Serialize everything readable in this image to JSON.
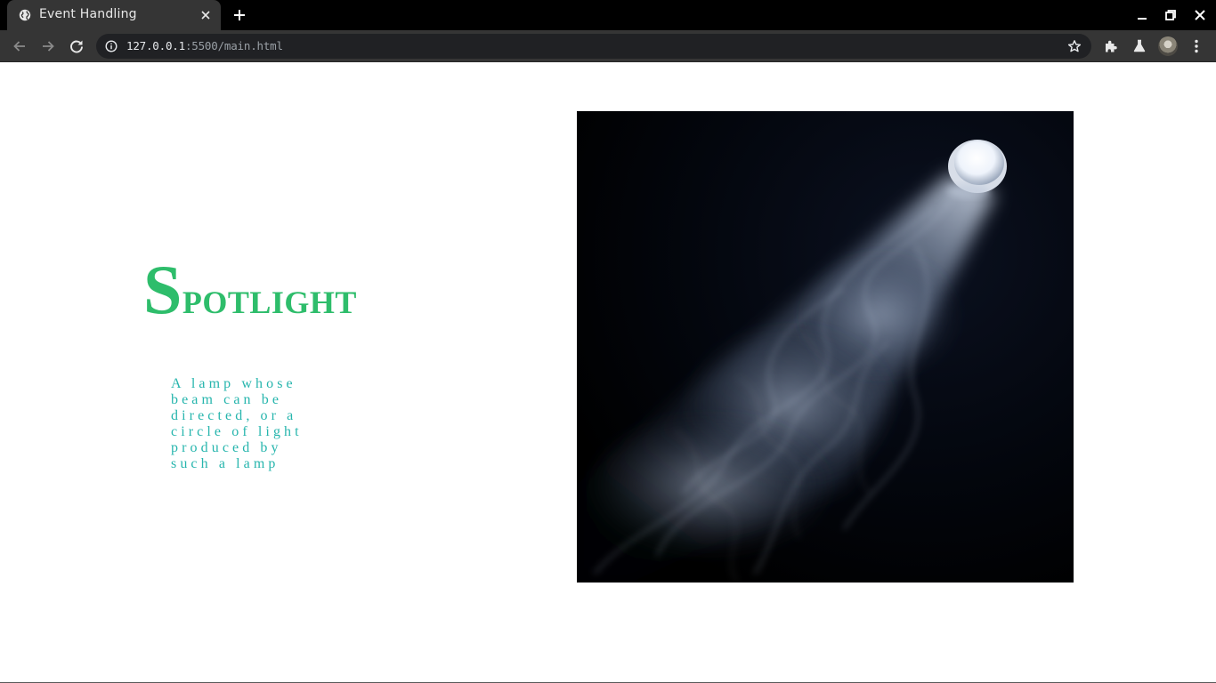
{
  "browser": {
    "tab_title": "Event Handling",
    "url_host": "127.0.0.1",
    "url_rest": ":5500/main.html",
    "icons": {
      "favicon": "globe-icon",
      "tab_close": "close-icon",
      "new_tab": "plus-icon",
      "minimize": "minimize-icon",
      "restore": "restore-icon",
      "close_window": "close-icon",
      "back": "arrow-left-icon",
      "forward": "arrow-right-icon",
      "reload": "reload-icon",
      "site_info": "info-icon",
      "bookmark": "star-icon",
      "extensions": "puzzle-icon",
      "labs": "flask-icon",
      "profile": "avatar",
      "menu": "kebab-menu-icon"
    }
  },
  "page": {
    "headline_first": "S",
    "headline_rest": "potlight",
    "description": "A lamp whose beam can be directed, or a circle of light produced by such a lamp",
    "image_alt": "spotlight beam through smoke",
    "colors": {
      "headline": "#2ebd6b",
      "description": "#26b5ad",
      "image_background": "#02040a"
    }
  }
}
